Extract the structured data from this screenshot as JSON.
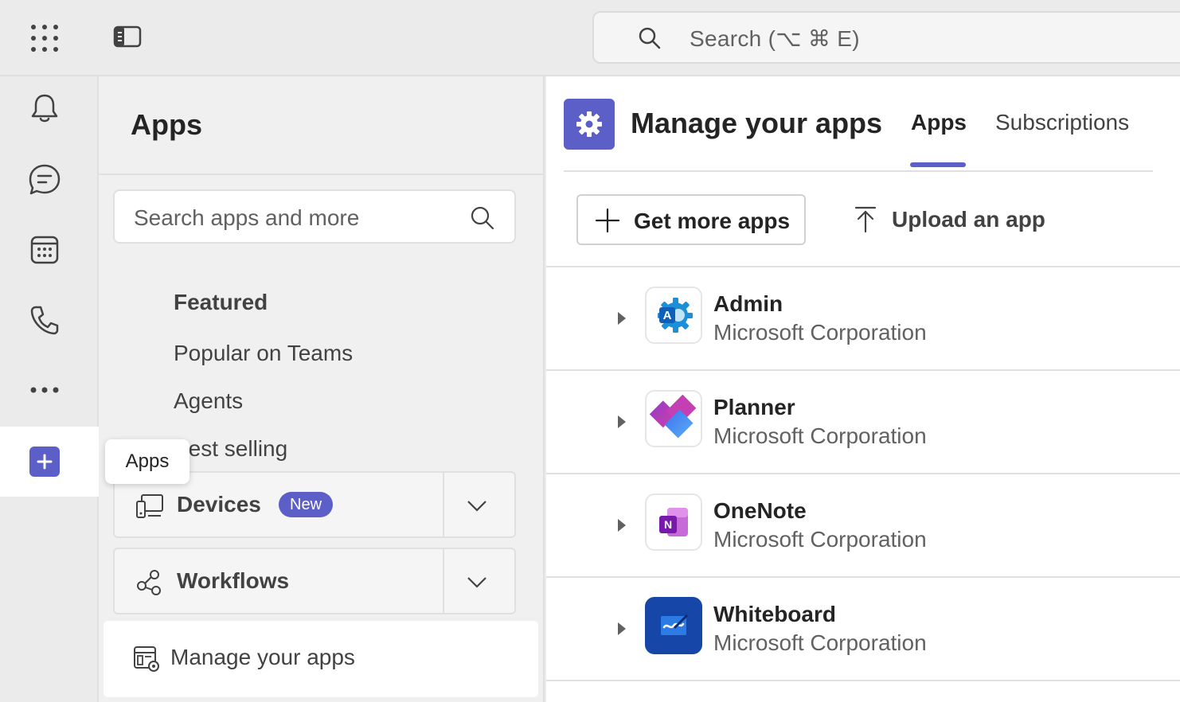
{
  "topbar": {
    "search_placeholder": "Search (⌥ ⌘ E)"
  },
  "rail": {
    "items": [
      "Activity",
      "Chat",
      "Calendar",
      "Calls",
      "More",
      "Apps"
    ],
    "tooltip": "Apps"
  },
  "apps_panel": {
    "title": "Apps",
    "search_placeholder": "Search apps and more",
    "categories": {
      "featured": "Featured",
      "popular": "Popular on Teams",
      "agents": "Agents",
      "best_selling": "Best selling"
    },
    "devices": {
      "label": "Devices",
      "badge": "New"
    },
    "workflows": {
      "label": "Workflows"
    },
    "manage": "Manage your apps"
  },
  "main": {
    "title": "Manage your apps",
    "tabs": [
      "Apps",
      "Subscriptions"
    ],
    "get_more_apps": "Get more apps",
    "upload_app": "Upload an app",
    "apps": [
      {
        "name": "Admin",
        "publisher": "Microsoft Corporation"
      },
      {
        "name": "Planner",
        "publisher": "Microsoft Corporation"
      },
      {
        "name": "OneNote",
        "publisher": "Microsoft Corporation"
      },
      {
        "name": "Whiteboard",
        "publisher": "Microsoft Corporation"
      }
    ]
  },
  "colors": {
    "accent": "#5b5fc7",
    "background": "#ebebeb",
    "panel": "#f0f0f0"
  }
}
